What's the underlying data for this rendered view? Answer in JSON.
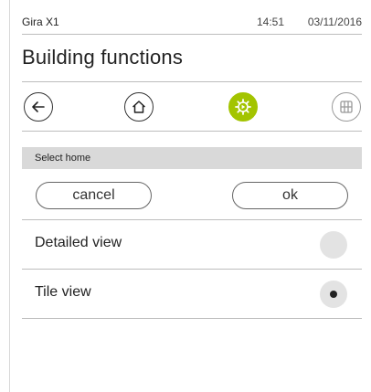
{
  "status": {
    "app_name": "Gira X1",
    "time": "14:51",
    "date": "03/11/2016"
  },
  "page": {
    "title": "Building functions"
  },
  "nav": {
    "items": [
      {
        "icon": "back-arrow-icon"
      },
      {
        "icon": "home-icon"
      },
      {
        "icon": "settings-gear-icon",
        "state": "active"
      },
      {
        "icon": "grid-view-icon"
      }
    ],
    "active_color": "#a3c400"
  },
  "section": {
    "title": "Select home"
  },
  "actions": {
    "cancel_label": "cancel",
    "ok_label": "ok"
  },
  "options": [
    {
      "label": "Detailed view",
      "selected": false
    },
    {
      "label": "Tile view",
      "selected": true
    }
  ]
}
